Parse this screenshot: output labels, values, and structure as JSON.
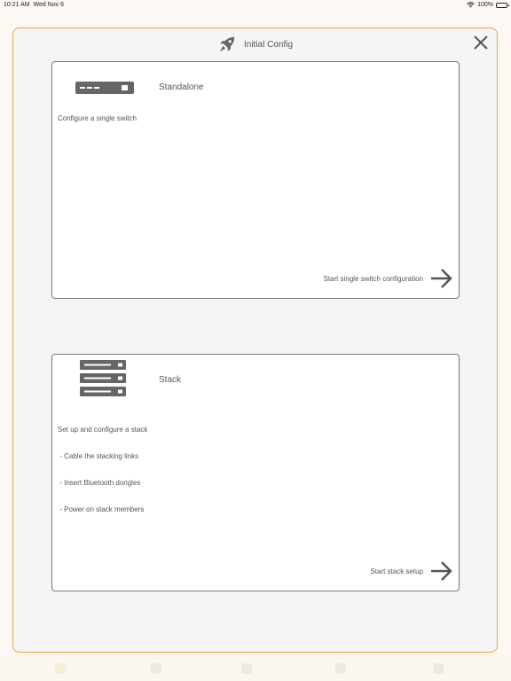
{
  "status_bar": {
    "time": "10:21 AM",
    "date": "Wed Nov 6",
    "battery": "100%",
    "wifi_icon": "wifi-icon",
    "battery_icon": "battery-icon"
  },
  "modal": {
    "title": "Initial Config",
    "title_icon": "rocket-icon",
    "close_icon": "close-icon"
  },
  "cards": {
    "standalone": {
      "icon": "switch-icon",
      "title": "Standalone",
      "description": [
        "Configure a single switch"
      ],
      "action_label": "Start single switch configuration",
      "action_icon": "arrow-right-icon"
    },
    "stack": {
      "icon": "stack-icon",
      "title": "Stack",
      "description": [
        "Set up and configure a stack",
        " - Cable the stacking links",
        " - Insert Bluetooth dongles",
        " - Power on stack members"
      ],
      "action_label": "Start stack setup",
      "action_icon": "arrow-right-icon"
    }
  },
  "colors": {
    "accent": "#f0a43c",
    "icon_gray": "#666666",
    "card_border": "#777777"
  }
}
